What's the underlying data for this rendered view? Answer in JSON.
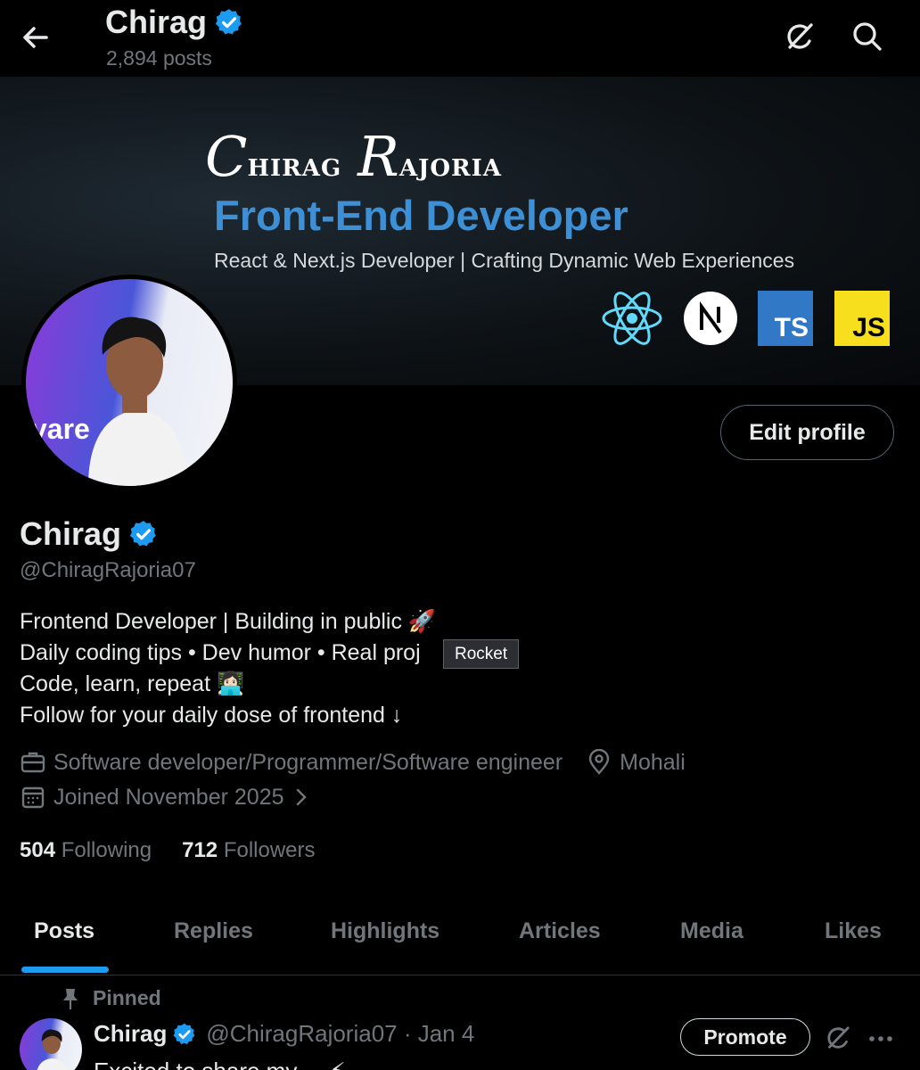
{
  "header": {
    "name": "Chirag",
    "post_count": "2,894 posts"
  },
  "banner": {
    "signature_first_initial": "C",
    "signature_first_rest": "HIRAG",
    "signature_last_initial": "R",
    "signature_last_rest": "AJORIA",
    "title": "Front-End Developer",
    "subtitle": "React & Next.js Developer | Crafting Dynamic Web Experiences",
    "ts_label": "TS",
    "js_label": "JS",
    "colors": {
      "title": "#3d8fd6",
      "ts": "#3178c6",
      "js": "#f7df1e"
    }
  },
  "avatar": {
    "word": "vare"
  },
  "actions": {
    "edit_profile": "Edit profile"
  },
  "profile": {
    "name": "Chirag",
    "handle": "@ChiragRajoria07",
    "bio": [
      "Frontend Developer | Building in public 🚀",
      "Daily coding tips • Dev humor • Real proj",
      "Code, learn, repeat 👩🏻‍💻",
      "Follow for your daily dose of frontend ↓"
    ],
    "tooltip": "Rocket",
    "profession": "Software developer/Programmer/Software engineer",
    "location": "Mohali",
    "joined": "Joined November 2025",
    "following_count": "504",
    "following_label": "Following",
    "followers_count": "712",
    "followers_label": "Followers"
  },
  "tabs": [
    "Posts",
    "Replies",
    "Highlights",
    "Articles",
    "Media",
    "Likes"
  ],
  "post": {
    "pinned_label": "Pinned",
    "author": "Chirag",
    "handle_date": "@ChiragRajoria07 · Jan 4",
    "promote_label": "Promote",
    "more_label": "···",
    "text_partial": "Excited to share my ...   ⚡"
  },
  "colors": {
    "accent": "#1d9bf0",
    "verified": "#1d9bf0",
    "muted": "#71767b"
  }
}
